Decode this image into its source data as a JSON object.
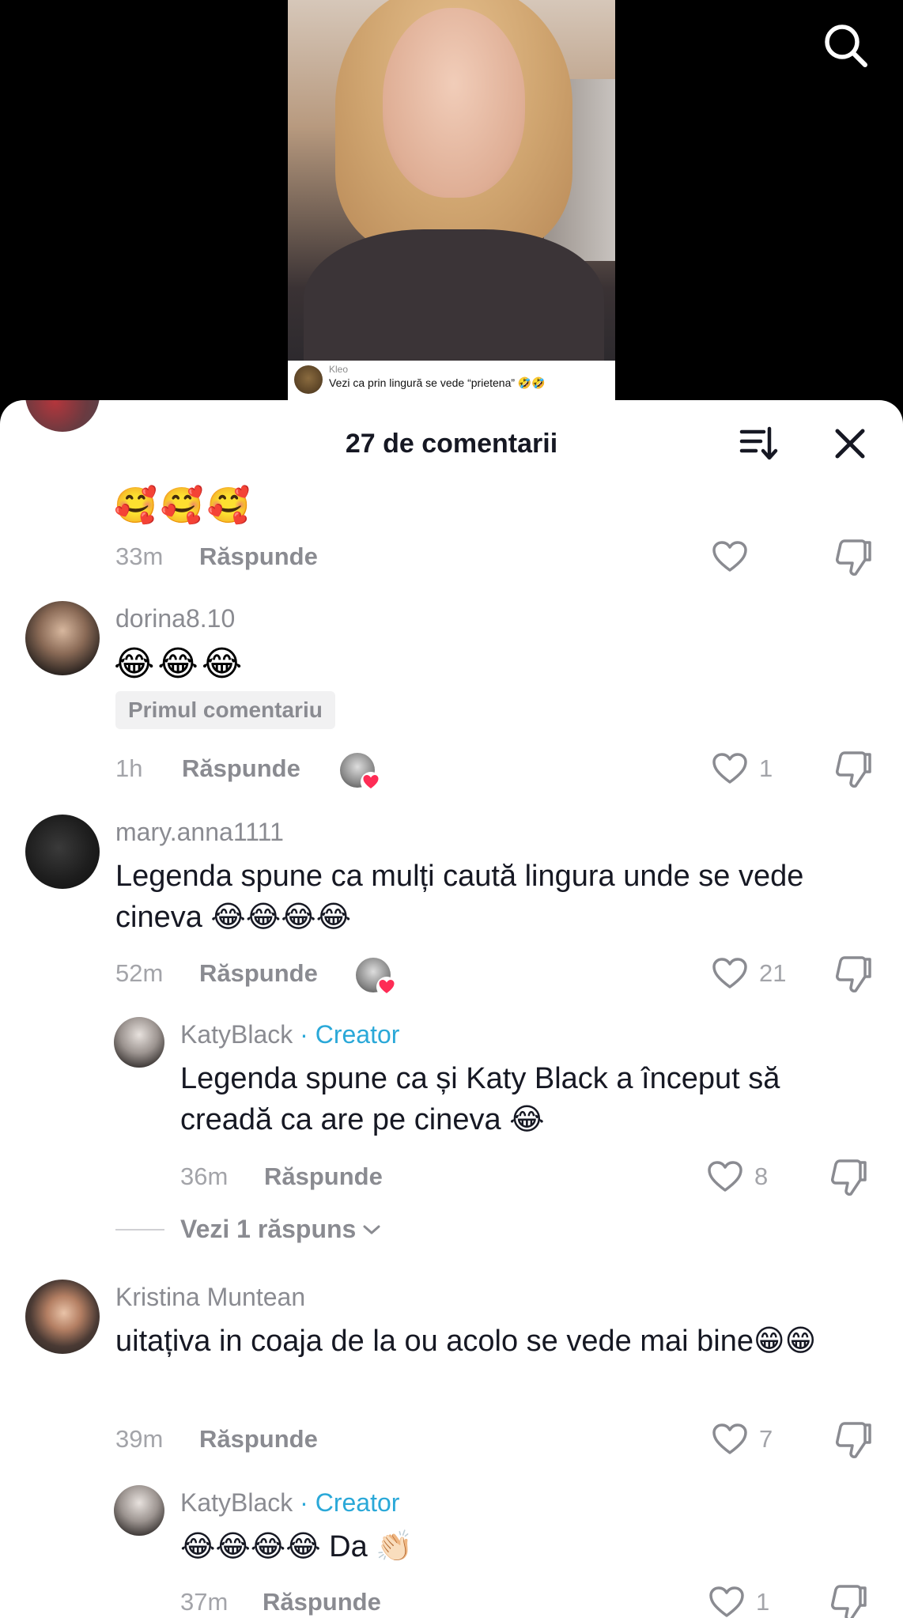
{
  "video": {
    "caption_user": "Kleo",
    "caption_text": "Vezi ca prin lingură se vede “prietena” 🤣🤣"
  },
  "header": {
    "title": "27 de comentarii",
    "search_icon": "search-icon",
    "sort_icon": "sort-icon",
    "close_icon": "close-icon"
  },
  "colors": {
    "creator": "#2aa8d8",
    "text": "#161823",
    "muted": "#8a8b91",
    "heart_badge": "#fe2c55"
  },
  "comments": [
    {
      "text": "🥰🥰🥰",
      "time": "33m",
      "reply_label": "Răspunde",
      "likes": ""
    },
    {
      "username": "dorina8.10",
      "text": "😂😂😂",
      "badge": "Primul comentariu",
      "time": "1h",
      "reply_label": "Răspunde",
      "likes": "1"
    },
    {
      "username": "mary.anna1111",
      "text": "Legenda spune ca mulți caută lingura unde se vede cineva 😂😂😂😂",
      "time": "52m",
      "reply_label": "Răspunde",
      "likes": "21",
      "reply": {
        "username": "KatyBlack",
        "creator_label": "· Creator",
        "text": "Legenda spune ca și Katy Black a început să creadă ca are pe cineva 😂",
        "time": "36m",
        "reply_label": "Răspunde",
        "likes": "8"
      },
      "view_replies": "Vezi 1 răspuns"
    },
    {
      "username": "Kristina Muntean",
      "text": "uitațiva in coaja de la ou acolo se vede mai bine😁😁",
      "time": "39m",
      "reply_label": "Răspunde",
      "likes": "7",
      "reply": {
        "username": "KatyBlack",
        "creator_label": "· Creator",
        "text": "😂😂😂😂 Da 👏🏻",
        "time": "37m",
        "reply_label": "Răspunde",
        "likes": "1"
      }
    }
  ]
}
